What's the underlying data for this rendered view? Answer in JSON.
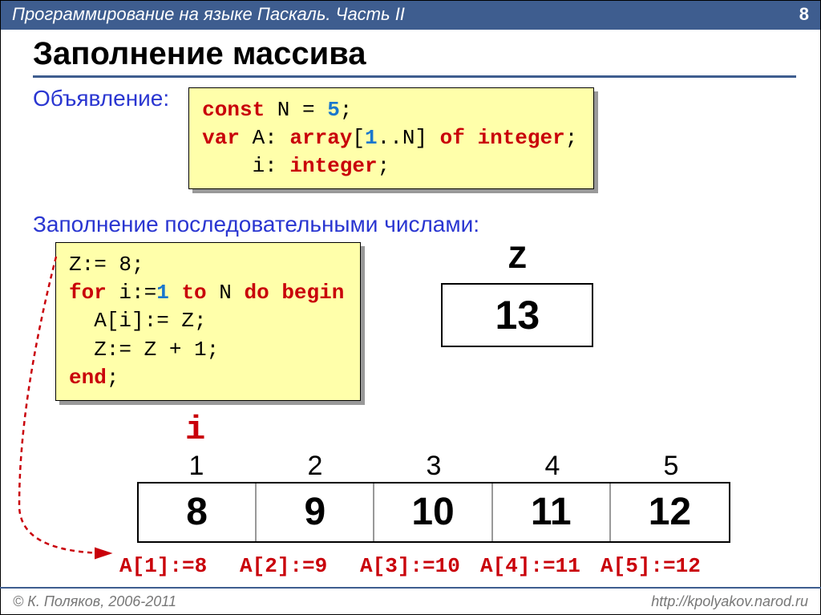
{
  "header": {
    "title": "Программирование на языке Паскаль. Часть II",
    "page": "8"
  },
  "slide": {
    "title": "Заполнение массива",
    "decl_label": "Объявление:",
    "code1": {
      "l1a": "const",
      "l1b": " N = ",
      "l1c": "5",
      "l1d": ";",
      "l2a": "var",
      "l2b": " A: ",
      "l2c": "array",
      "l2d": "[",
      "l2e": "1",
      "l2f": "..N] ",
      "l2g": "of",
      "l2h": " ",
      "l2i": "integer",
      "l2j": ";",
      "l3a": "    i: ",
      "l3b": "integer",
      "l3c": ";"
    },
    "fill_label": "Заполнение последовательными числами:",
    "code2": {
      "l1": "Z:= 8;",
      "l2a": "for",
      "l2b": " i:=",
      "l2c": "1",
      "l2d": " ",
      "l2e": "to",
      "l2f": " N ",
      "l2g": "do",
      "l2h": " ",
      "l2i": "begin",
      "l3": "  A[i]:= Z;",
      "l4": "  Z:= Z + 1;",
      "l5": "end",
      "l5b": ";"
    },
    "z_label": "Z",
    "z_value": "13",
    "i_label": "i",
    "indices": [
      "1",
      "2",
      "3",
      "4",
      "5"
    ],
    "values": [
      "8",
      "9",
      "10",
      "11",
      "12"
    ],
    "assigns": [
      "A[1]:=8",
      "A[2]:=9",
      "A[3]:=10",
      "A[4]:=11",
      "A[5]:=12"
    ]
  },
  "footer": {
    "left": "© К. Поляков, 2006-2011",
    "right": "http://kpolyakov.narod.ru"
  }
}
